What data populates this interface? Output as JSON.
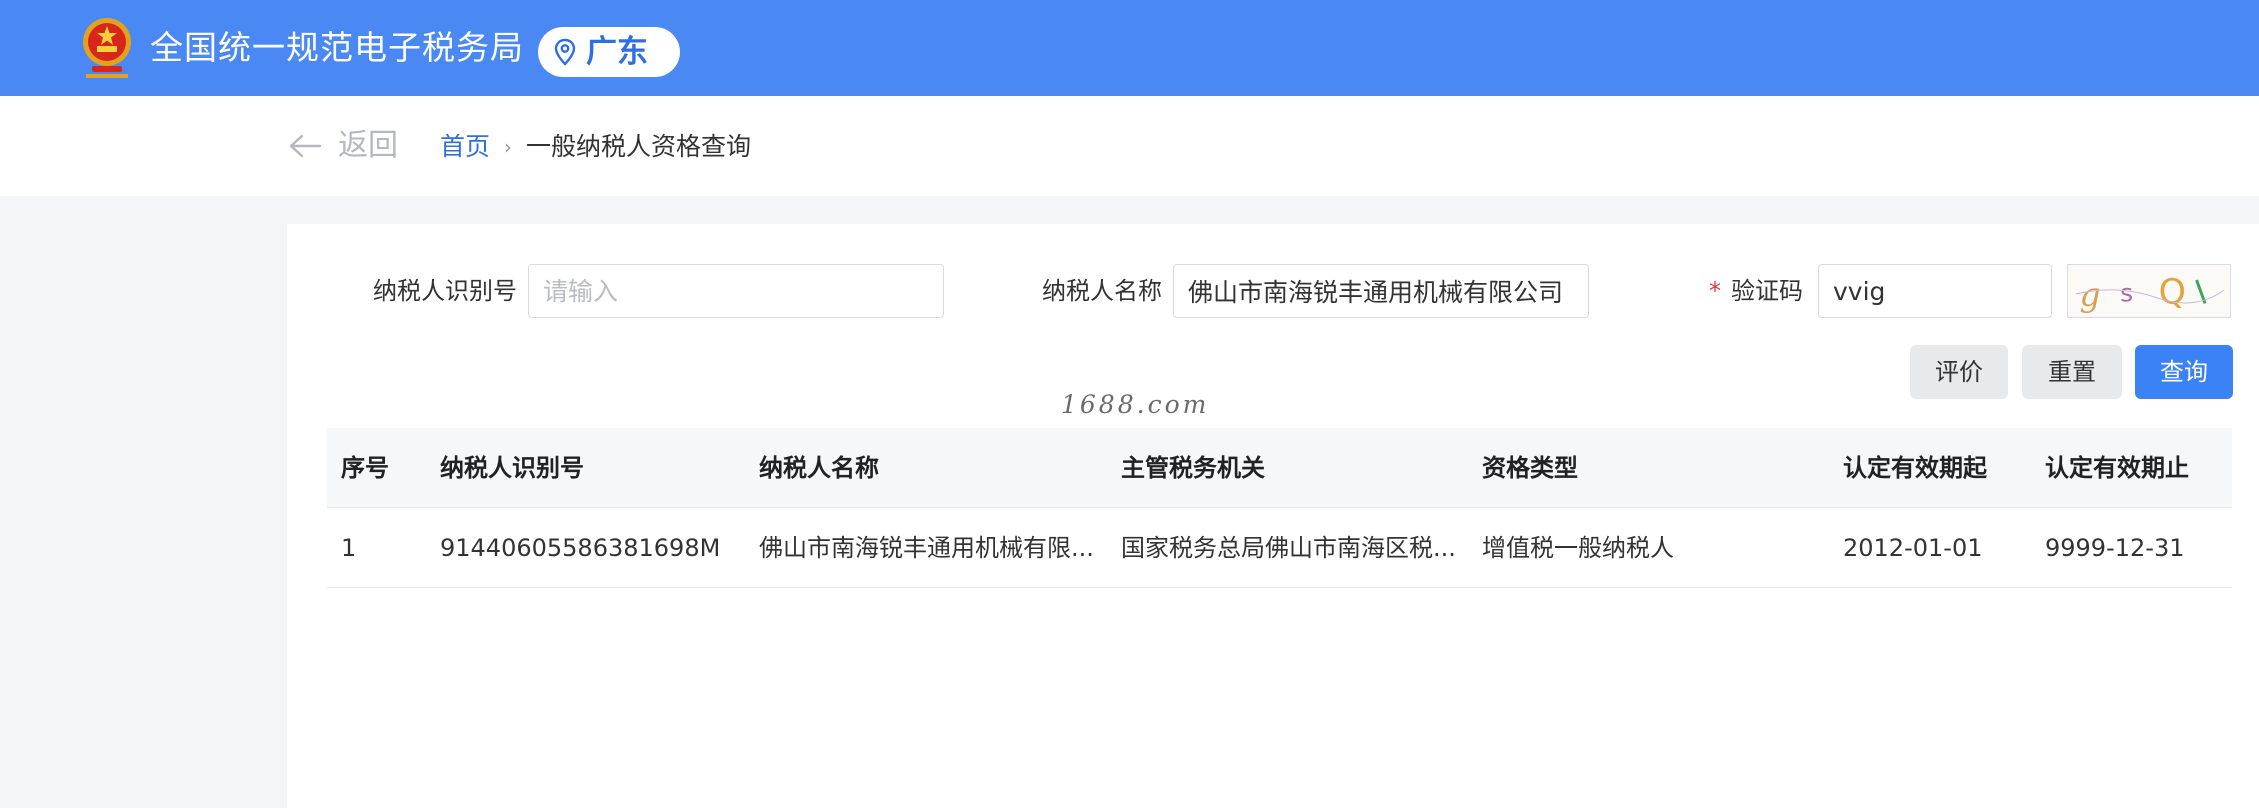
{
  "header": {
    "site_title": "全国统一规范电子税务局",
    "region": "广东",
    "accent_color": "#4a89f3"
  },
  "breadcrumb": {
    "back_label": "返回",
    "home": "首页",
    "current": "一般纳税人资格查询"
  },
  "form": {
    "taxpayer_id_label": "纳税人识别号",
    "taxpayer_id_placeholder": "请输入",
    "taxpayer_id_value": "",
    "taxpayer_name_label": "纳税人名称",
    "taxpayer_name_value": "佛山市南海锐丰通用机械有限公司",
    "required_mark": "*",
    "captcha_label": "验证码",
    "captcha_value": "vvig",
    "captcha_image_text": "g s Q l"
  },
  "buttons": {
    "rate": "评价",
    "reset": "重置",
    "query": "查询"
  },
  "watermark": "1688.com",
  "table": {
    "columns": [
      "序号",
      "纳税人识别号",
      "纳税人名称",
      "主管税务机关",
      "资格类型",
      "认定有效期起",
      "认定有效期止"
    ],
    "rows": [
      [
        "1",
        "91440605586381698M",
        "佛山市南海锐丰通用机械有限...",
        "国家税务总局佛山市南海区税...",
        "增值税一般纳税人",
        "2012-01-01",
        "9999-12-31"
      ]
    ]
  }
}
